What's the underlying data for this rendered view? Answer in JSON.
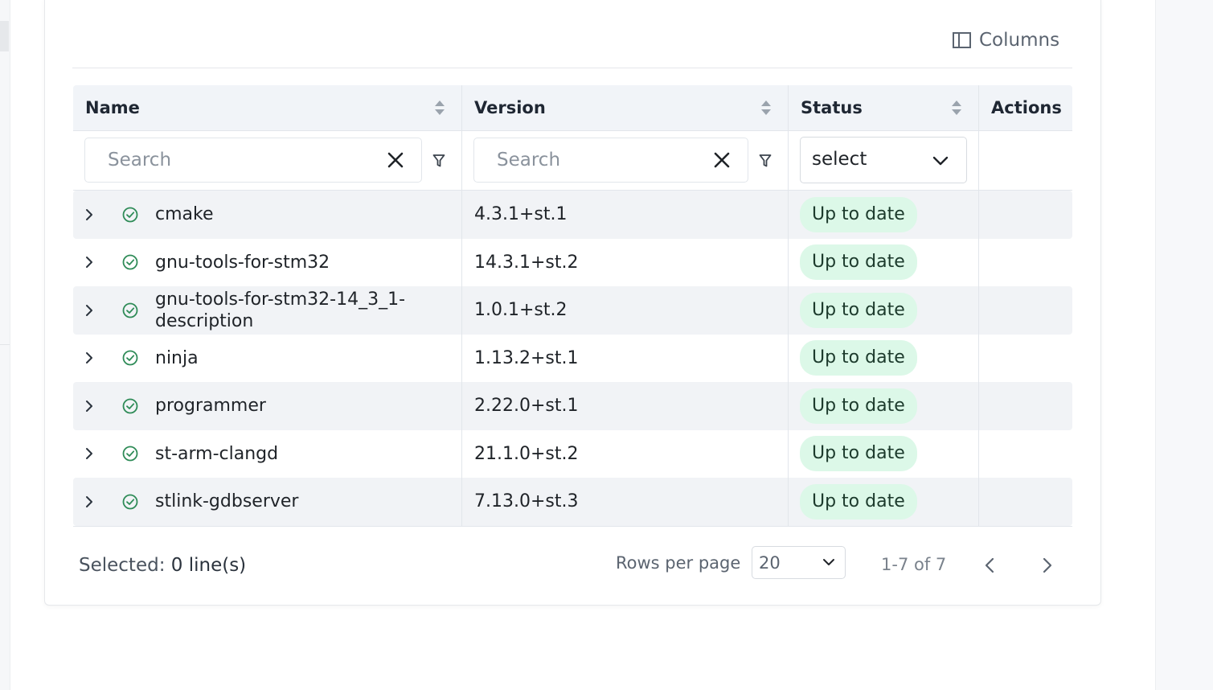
{
  "toolbar": {
    "columns_label": "Columns"
  },
  "table": {
    "headers": {
      "name": "Name",
      "version": "Version",
      "status": "Status",
      "actions": "Actions"
    },
    "filters": {
      "name_placeholder": "Search",
      "version_placeholder": "Search",
      "status_value": "select"
    },
    "rows": [
      {
        "name": "cmake",
        "version": "4.3.1+st.1",
        "status": "Up to date"
      },
      {
        "name": "gnu-tools-for-stm32",
        "version": "14.3.1+st.2",
        "status": "Up to date"
      },
      {
        "name": "gnu-tools-for-stm32-14_3_1-description",
        "version": "1.0.1+st.2",
        "status": "Up to date"
      },
      {
        "name": "ninja",
        "version": "1.13.2+st.1",
        "status": "Up to date"
      },
      {
        "name": "programmer",
        "version": "2.22.0+st.1",
        "status": "Up to date"
      },
      {
        "name": "st-arm-clangd",
        "version": "21.1.0+st.2",
        "status": "Up to date"
      },
      {
        "name": "stlink-gdbserver",
        "version": "7.13.0+st.3",
        "status": "Up to date"
      }
    ]
  },
  "footer": {
    "selected_label": "Selected:",
    "selected_count": "0 line(s)",
    "rows_per_page_label": "Rows per page",
    "rows_per_page_value": "20",
    "range": "1-7 of 7"
  },
  "colors": {
    "badge_bg": "#dcf8e8",
    "status_icon": "#2e8b57",
    "header_bg": "#f1f4f8",
    "stripe_bg": "#f1f3f6"
  }
}
